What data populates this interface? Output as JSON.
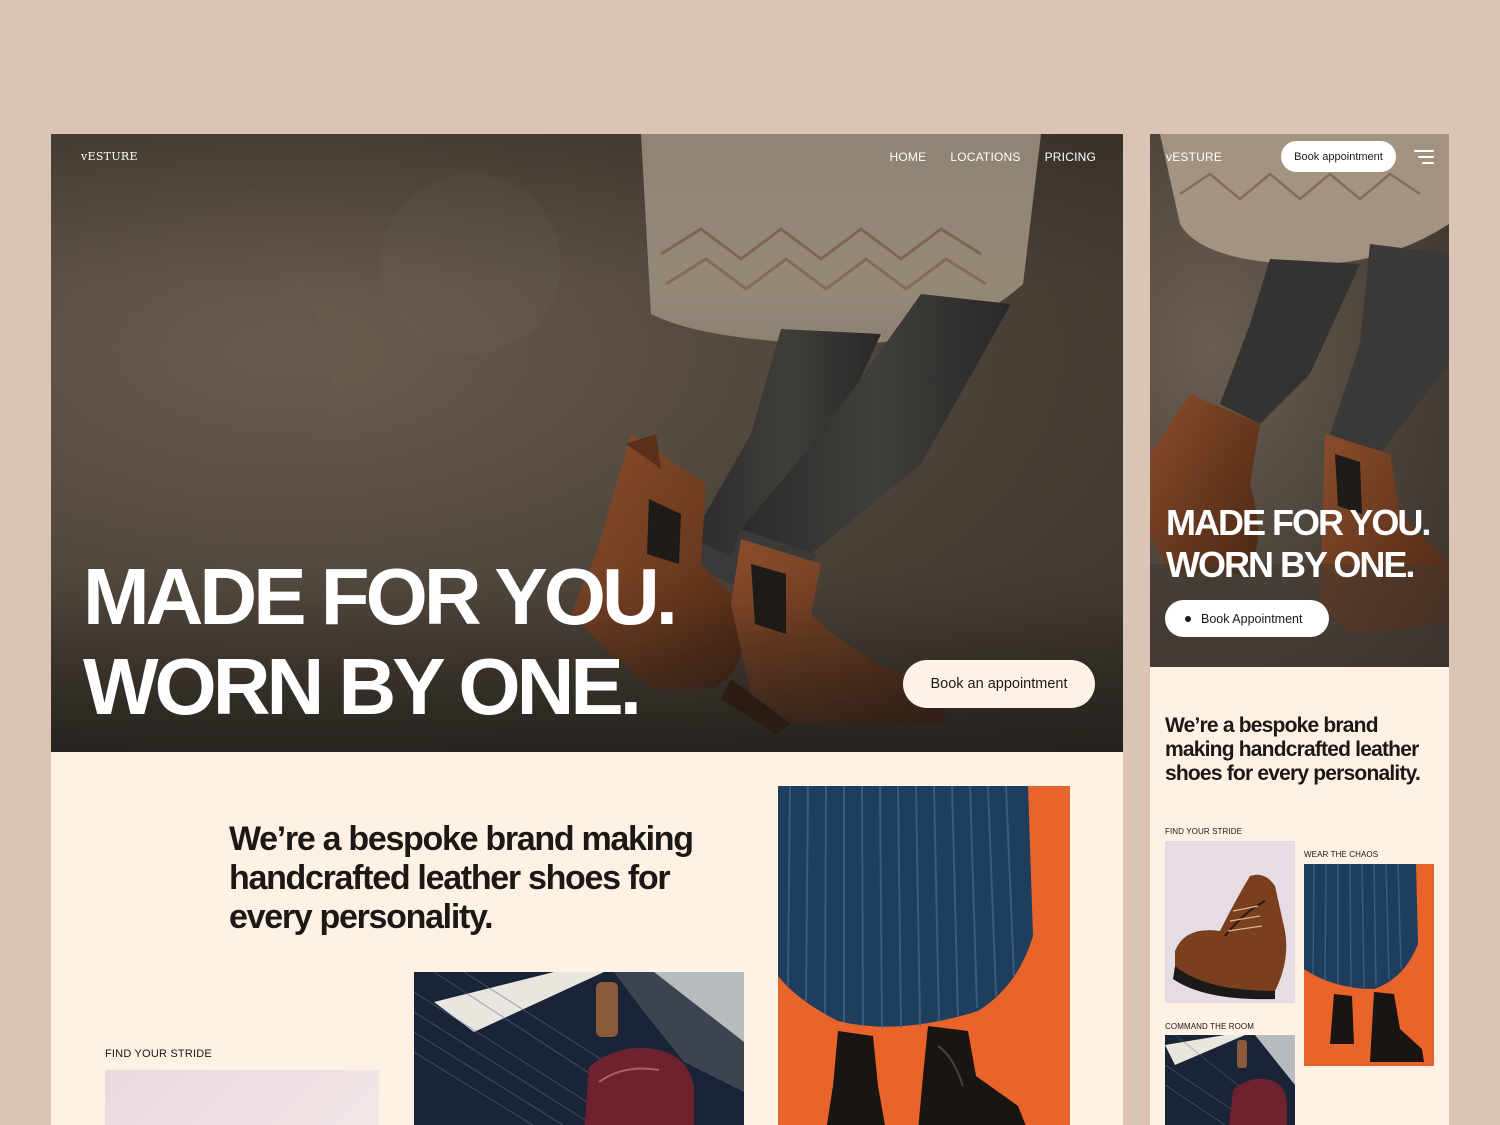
{
  "desktop": {
    "logo": "vESTURE",
    "nav": [
      "HOME",
      "LOCATIONS",
      "PRICING"
    ],
    "headline": [
      "MADE FOR YOU.",
      "WORN BY ONE."
    ],
    "cta": "Book an appointment",
    "intro": "We’re a bespoke brand making handcrafted leather shoes for every personality.",
    "caption": "FIND YOUR STRIDE"
  },
  "mobile": {
    "logo": "vESTURE",
    "book_button": "Book appointment",
    "headline": [
      "MADE FOR YOU.",
      "WORN BY ONE."
    ],
    "cta": "Book Appointment",
    "intro": "We’re a bespoke brand making handcrafted leather shoes for every personality.",
    "captions": [
      "FIND YOUR STRIDE",
      "WEAR THE CHAOS",
      "COMMAND THE ROOM"
    ]
  },
  "colors": {
    "page_background": "#dcc4b4",
    "cream": "#fff1e4",
    "hero_dark": "#4f463c",
    "leather_brown": "#6b3a1f",
    "orange": "#e8642a",
    "navy_pleat": "#1f3d5c"
  },
  "icons": [
    "hamburger-menu-icon",
    "bullet-dot-icon"
  ]
}
